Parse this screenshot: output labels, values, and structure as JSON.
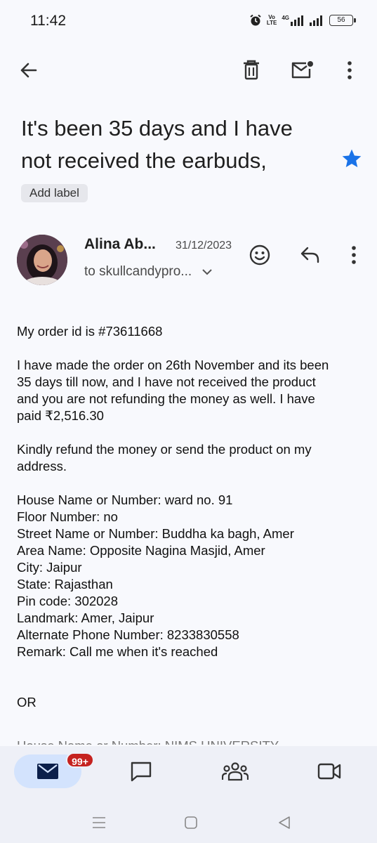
{
  "status_bar": {
    "time": "11:42",
    "volte_top": "Vo",
    "volte_mid": "LTE",
    "network": "4G",
    "battery": "56"
  },
  "toolbar": {
    "back_icon": "arrow-back-icon",
    "delete_icon": "trash-icon",
    "unread_icon": "mark-unread-icon",
    "more_icon": "more-vert-icon"
  },
  "email": {
    "subject": "It's been 35 days and I have not received the earbuds,",
    "label_chip": "Add label",
    "starred": true,
    "star_color": "#1a73e8",
    "sender_name": "Alina Ab...",
    "date": "31/12/2023",
    "recipient": "to skullcandypro...",
    "body": {
      "p1": "My order id is #73611668",
      "p2": [
        "I have made the order on 26th November and its been",
        "35 days till now, and I have not received the product",
        "and you are not refunding the money as well. I have",
        "paid ₹2,516.30"
      ],
      "p3": [
        "Kindly refund the money or send the product on my",
        "address."
      ],
      "address": [
        "House Name or Number: ward no. 91",
        "Floor Number: no",
        "Street Name or Number: Buddha ka bagh, Amer",
        "Area Name: Opposite Nagina Masjid, Amer",
        "City: Jaipur",
        "State: Rajasthan",
        "Pin code: 302028",
        "Landmark: Amer, Jaipur",
        "Alternate Phone Number: 8233830558",
        "Remark: Call me when it's reached"
      ],
      "or": "OR",
      "cut_line": "House Name or Number: NIMS UNIVERSITY"
    }
  },
  "bottom_nav": {
    "mail_badge": "99+",
    "badge_color": "#c5221f",
    "active_bg": "#d3e3fd",
    "items": [
      "mail-icon",
      "chat-icon",
      "spaces-icon",
      "meet-icon"
    ]
  }
}
